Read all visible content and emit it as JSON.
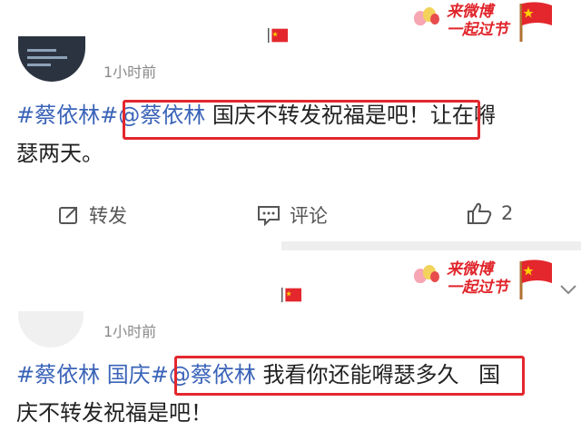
{
  "badge": {
    "line1": "来微博",
    "line2": "一起过节"
  },
  "posts": [
    {
      "time": "1小时前",
      "text_parts": [
        "#蔡依林#",
        "@蔡依林",
        " 国庆不转发祝福是吧！",
        "让在嘚",
        "瑟两天。"
      ],
      "actions": {
        "repost": "转发",
        "comment": "评论",
        "like_count": "2"
      }
    },
    {
      "time": "1小时前",
      "text_parts": [
        "#蔡依林 国庆#",
        "@蔡依林",
        " 我看你还能嘚瑟多久",
        " 国",
        "庆不转发祝福是吧！"
      ]
    }
  ],
  "colors": {
    "accent_red": "#e3272d",
    "hashtag_blue": "#3a63b8"
  },
  "icons": [
    "balloon-icon",
    "china-flag-icon",
    "repost-icon",
    "comment-icon",
    "like-icon"
  ]
}
